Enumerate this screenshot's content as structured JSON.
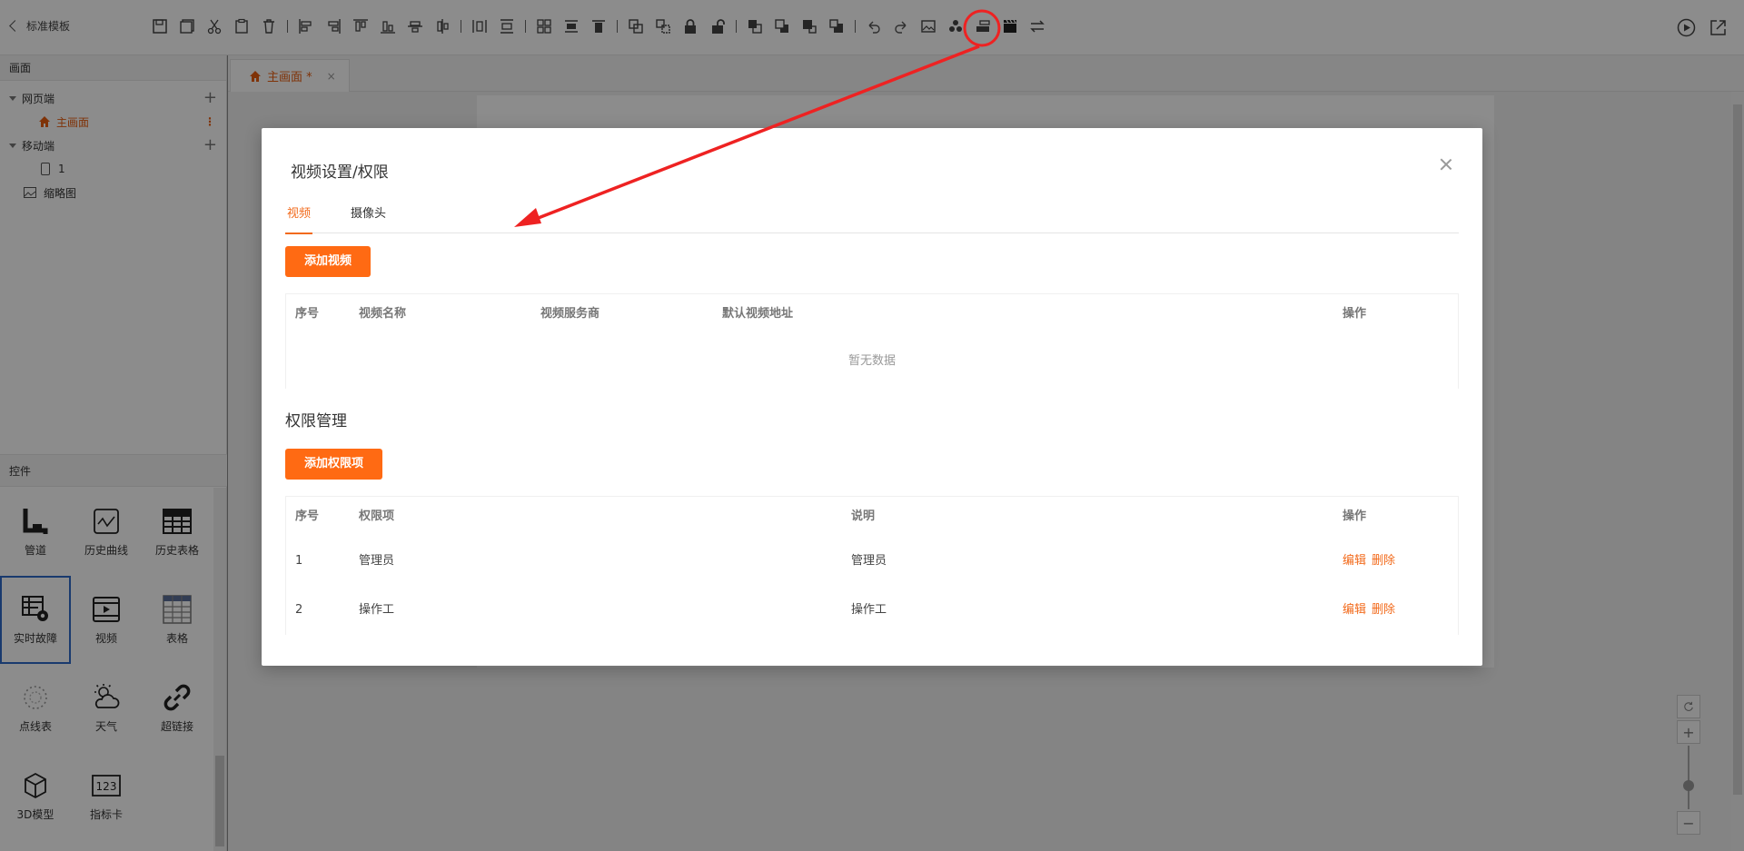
{
  "header": {
    "back_label": "标准模板",
    "tool_icons": [
      "save-icon",
      "save-as-icon",
      "cut-icon",
      "paste-icon",
      "delete-icon",
      "align-left-icon",
      "align-right-icon",
      "align-top-icon",
      "align-bottom-icon",
      "align-center-v-icon",
      "align-center-h-icon",
      "distribute-h-icon",
      "distribute-v-icon",
      "group-icon",
      "same-width-icon",
      "same-height-icon",
      "combine-icon",
      "uncombine-icon",
      "lock-icon",
      "unlock-icon",
      "bring-front-icon",
      "send-back-icon",
      "bring-forward-icon",
      "send-backward-icon",
      "undo-icon",
      "redo-icon",
      "image-icon",
      "components-icon",
      "layers-icon",
      "video-settings-icon",
      "switch-icon"
    ],
    "right_icons": [
      "play-icon",
      "open-external-icon"
    ]
  },
  "sidebar": {
    "screens_title": "画面",
    "tree": {
      "web": "网页端",
      "main_screen": "主画面",
      "mobile": "移动端",
      "mobile_item": "1",
      "thumbnail": "缩略图"
    },
    "controls_title": "控件",
    "controls": [
      {
        "label": "管道",
        "icon": "pipe-icon"
      },
      {
        "label": "历史曲线",
        "icon": "history-curve-icon"
      },
      {
        "label": "历史表格",
        "icon": "history-table-icon"
      },
      {
        "label": "实时故障",
        "icon": "realtime-fault-icon"
      },
      {
        "label": "视频",
        "icon": "video-icon"
      },
      {
        "label": "表格",
        "icon": "table-icon"
      },
      {
        "label": "点线表",
        "icon": "dot-line-icon"
      },
      {
        "label": "天气",
        "icon": "weather-icon"
      },
      {
        "label": "超链接",
        "icon": "hyperlink-icon"
      },
      {
        "label": "3D模型",
        "icon": "cube-icon"
      },
      {
        "label": "指标卡",
        "icon": "indicator-card-icon"
      }
    ]
  },
  "tabs": {
    "main_tab": "主画面 *",
    "close": "×"
  },
  "modal": {
    "title": "视频设置/权限",
    "tabs": [
      "视频",
      "摄像头"
    ],
    "add_video": "添加视频",
    "video_table": {
      "headers": [
        "序号",
        "视频名称",
        "视频服务商",
        "默认视频地址",
        "操作"
      ],
      "empty_text": "暂无数据"
    },
    "permission_title": "权限管理",
    "add_permission": "添加权限项",
    "perm_table": {
      "headers": [
        "序号",
        "权限项",
        "说明",
        "操作"
      ],
      "rows": [
        {
          "no": "1",
          "item": "管理员",
          "desc": "管理员",
          "edit": "编辑",
          "delete": "删除"
        },
        {
          "no": "2",
          "item": "操作工",
          "desc": "操作工",
          "edit": "编辑",
          "delete": "删除"
        }
      ]
    }
  },
  "colors": {
    "accent": "#ff6a13",
    "annotation": "#ee2222"
  }
}
